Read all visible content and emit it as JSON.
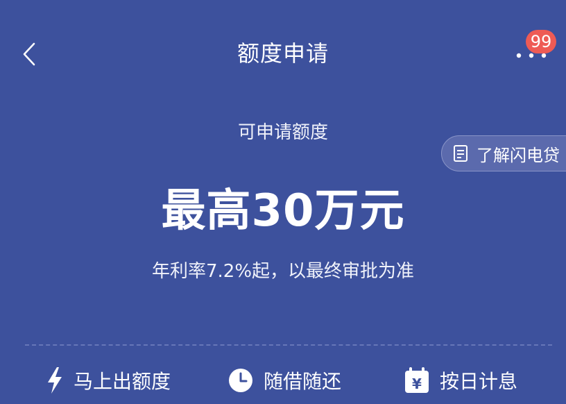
{
  "header": {
    "title": "额度申请",
    "badge_count": "99"
  },
  "side_pill": {
    "label": "了解闪电贷"
  },
  "main": {
    "subtitle": "可申请额度",
    "amount": "最高30万元",
    "rate_note": "年利率7.2%起，以最终审批为准"
  },
  "features": [
    {
      "icon": "lightning-icon",
      "label": "马上出额度"
    },
    {
      "icon": "clock-icon",
      "label": "随借随还"
    },
    {
      "icon": "calendar-yen-icon",
      "label": "按日计息"
    }
  ],
  "colors": {
    "background": "#3d519d",
    "badge": "#ee5b55",
    "pill": "#5b6aad"
  }
}
